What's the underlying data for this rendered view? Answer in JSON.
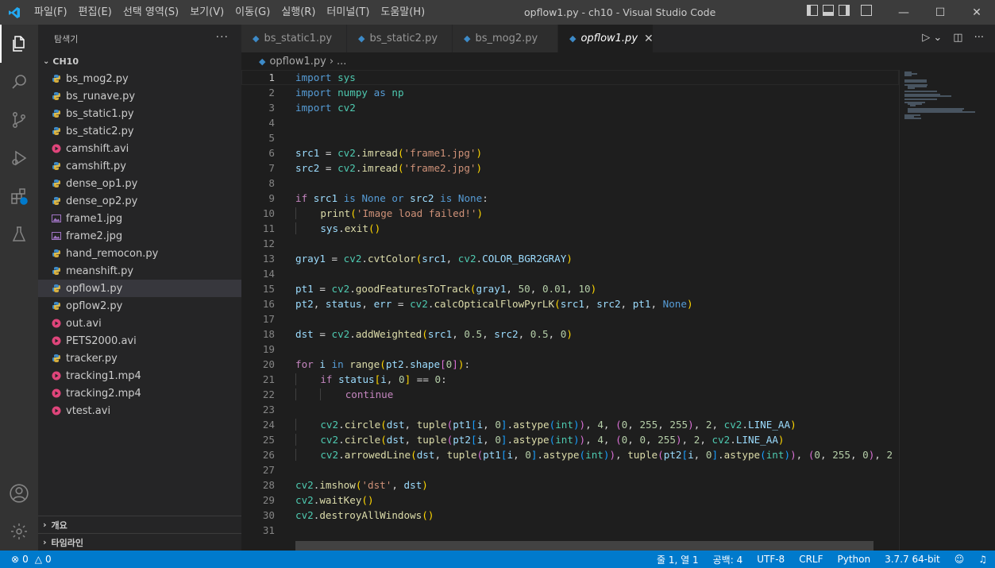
{
  "window": {
    "title": "opflow1.py - ch10 - Visual Studio Code",
    "menu": [
      "파일(F)",
      "편집(E)",
      "선택 영역(S)",
      "보기(V)",
      "이동(G)",
      "실행(R)",
      "터미널(T)",
      "도움말(H)"
    ]
  },
  "sidebar": {
    "title": "탐색기",
    "more": "···",
    "folder": "CH10",
    "files": [
      {
        "name": "bs_mog2.py",
        "type": "py"
      },
      {
        "name": "bs_runave.py",
        "type": "py"
      },
      {
        "name": "bs_static1.py",
        "type": "py"
      },
      {
        "name": "bs_static2.py",
        "type": "py"
      },
      {
        "name": "camshift.avi",
        "type": "media"
      },
      {
        "name": "camshift.py",
        "type": "py"
      },
      {
        "name": "dense_op1.py",
        "type": "py"
      },
      {
        "name": "dense_op2.py",
        "type": "py"
      },
      {
        "name": "frame1.jpg",
        "type": "image"
      },
      {
        "name": "frame2.jpg",
        "type": "image"
      },
      {
        "name": "hand_remocon.py",
        "type": "py"
      },
      {
        "name": "meanshift.py",
        "type": "py"
      },
      {
        "name": "opflow1.py",
        "type": "py"
      },
      {
        "name": "opflow2.py",
        "type": "py"
      },
      {
        "name": "out.avi",
        "type": "media"
      },
      {
        "name": "PETS2000.avi",
        "type": "media"
      },
      {
        "name": "tracker.py",
        "type": "py"
      },
      {
        "name": "tracking1.mp4",
        "type": "media"
      },
      {
        "name": "tracking2.mp4",
        "type": "media"
      },
      {
        "name": "vtest.avi",
        "type": "media"
      }
    ],
    "selected_file": "opflow1.py",
    "outline_label": "개요",
    "timeline_label": "타임라인"
  },
  "tabs": [
    {
      "label": "bs_static1.py",
      "active": false
    },
    {
      "label": "bs_static2.py",
      "active": false
    },
    {
      "label": "bs_mog2.py",
      "active": false
    },
    {
      "label": "opflow1.py",
      "active": true
    }
  ],
  "breadcrumb": {
    "file": "opflow1.py",
    "rest": "..."
  },
  "editor": {
    "current_line": 1,
    "lines": [
      "import sys",
      "import numpy as np",
      "import cv2",
      "",
      "",
      "src1 = cv2.imread('frame1.jpg')",
      "src2 = cv2.imread('frame2.jpg')",
      "",
      "if src1 is None or src2 is None:",
      "    print('Image load failed!')",
      "    sys.exit()",
      "",
      "gray1 = cv2.cvtColor(src1, cv2.COLOR_BGR2GRAY)",
      "",
      "pt1 = cv2.goodFeaturesToTrack(gray1, 50, 0.01, 10)",
      "pt2, status, err = cv2.calcOpticalFlowPyrLK(src1, src2, pt1, None)",
      "",
      "dst = cv2.addWeighted(src1, 0.5, src2, 0.5, 0)",
      "",
      "for i in range(pt2.shape[0]):",
      "    if status[i, 0] == 0:",
      "        continue",
      "",
      "    cv2.circle(dst, tuple(pt1[i, 0].astype(int)), 4, (0, 255, 255), 2, cv2.LINE_AA)",
      "    cv2.circle(dst, tuple(pt2[i, 0].astype(int)), 4, (0, 0, 255), 2, cv2.LINE_AA)",
      "    cv2.arrowedLine(dst, tuple(pt1[i, 0].astype(int)), tuple(pt2[i, 0].astype(int)), (0, 255, 0), 2",
      "",
      "cv2.imshow('dst', dst)",
      "cv2.waitKey()",
      "cv2.destroyAllWindows()",
      ""
    ]
  },
  "statusbar": {
    "errors": "0",
    "warnings": "0",
    "position": "줄 1, 열 1",
    "indent": "공백: 4",
    "encoding": "UTF-8",
    "eol": "CRLF",
    "language": "Python",
    "interpreter": "3.7.7 64-bit"
  },
  "colors": {
    "accent": "#007acc",
    "titlebar": "#3c3c3c",
    "sidebar": "#252526",
    "editor": "#1e1e1e"
  }
}
